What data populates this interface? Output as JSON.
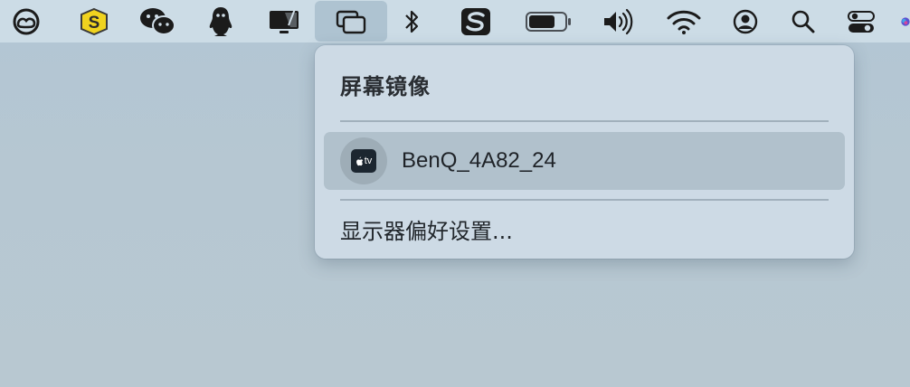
{
  "menubar": {
    "items": [
      {
        "name": "creative-cloud-icon"
      },
      {
        "name": "sogou-s-icon"
      },
      {
        "name": "wechat-icon"
      },
      {
        "name": "qq-penguin-icon"
      },
      {
        "name": "sidecar-display-icon"
      },
      {
        "name": "screen-mirroring-icon"
      },
      {
        "name": "bluetooth-icon"
      },
      {
        "name": "s-app-icon"
      },
      {
        "name": "battery-icon"
      },
      {
        "name": "volume-icon"
      },
      {
        "name": "wifi-icon"
      },
      {
        "name": "user-account-icon"
      },
      {
        "name": "spotlight-search-icon"
      },
      {
        "name": "control-center-icon"
      },
      {
        "name": "siri-icon"
      }
    ]
  },
  "popover": {
    "title": "屏幕镜像",
    "device": {
      "badge": "tv",
      "name": "BenQ_4A82_24"
    },
    "prefs_label": "显示器偏好设置..."
  }
}
